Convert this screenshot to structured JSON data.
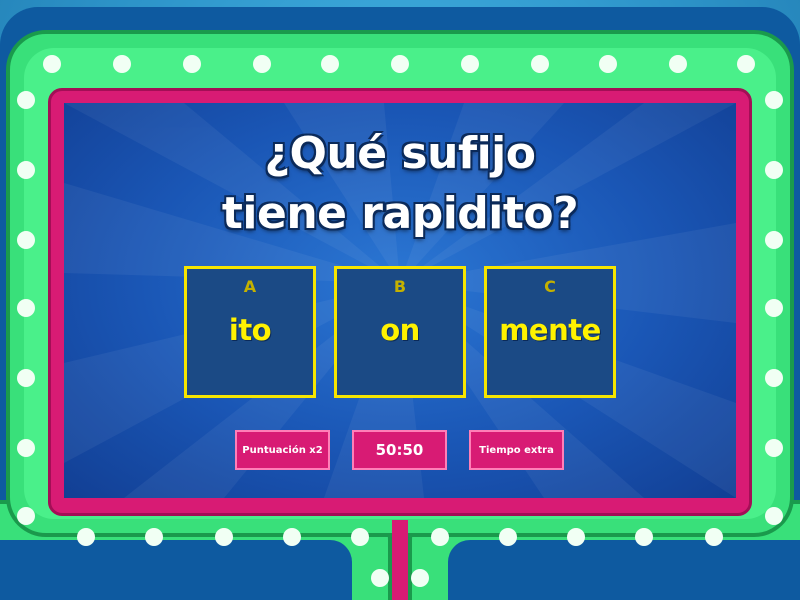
{
  "question": {
    "line1": "¿Qué sufijo",
    "line2": "tiene rapidito?"
  },
  "answers": [
    {
      "letter": "A",
      "text": "ito"
    },
    {
      "letter": "B",
      "text": "on"
    },
    {
      "letter": "C",
      "text": "mente"
    }
  ],
  "powerups": {
    "double_score": "Puntuación x2",
    "fifty_fifty": "50:50",
    "extra_time": "Tiempo extra"
  },
  "colors": {
    "board_blue": "#1a56b5",
    "frame_green": "#39e07a",
    "frame_pink": "#d81b74",
    "answer_border": "#f6e600",
    "answer_text": "#fff200"
  }
}
